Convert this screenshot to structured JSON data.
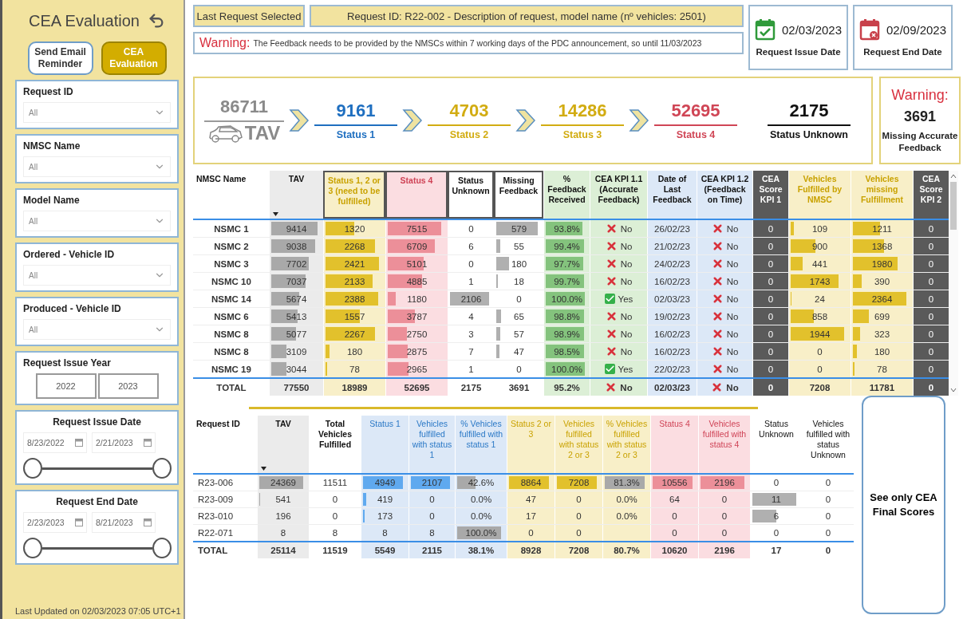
{
  "sidebar": {
    "title": "CEA Evaluation",
    "buttons": [
      {
        "label": "Send Email Reminder",
        "selected": false
      },
      {
        "label": "CEA Evaluation",
        "selected": true
      }
    ],
    "filters": [
      {
        "kind": "dropdown",
        "label": "Request ID",
        "placeholder": "All"
      },
      {
        "kind": "dropdown",
        "label": "NMSC Name",
        "placeholder": "All"
      },
      {
        "kind": "dropdown",
        "label": "Model Name",
        "placeholder": "All"
      },
      {
        "kind": "dropdown",
        "label": "Ordered - Vehicle ID",
        "placeholder": "All"
      },
      {
        "kind": "dropdown",
        "label": "Produced - Vehicle ID",
        "placeholder": "All"
      },
      {
        "kind": "years",
        "label": "Request Issue Year",
        "options": [
          "2022",
          "2023"
        ]
      },
      {
        "kind": "daterange",
        "label": "Request Issue Date",
        "start": "8/23/2022",
        "end": "2/21/2023"
      },
      {
        "kind": "daterange",
        "label": "Request End Date",
        "start": "2/23/2023",
        "end": "8/21/2023"
      }
    ],
    "footer": "Last Updated on 02/03/2023 07:05 UTC+1"
  },
  "header": {
    "selection_label": "Last Request Selected",
    "request": "Request ID: R22-002 - Description of request, model name (nº vehicles: 2501)",
    "warning": {
      "label": "Warning:",
      "text": "The Feedback needs to be provided by the NMSCs within 7 working days of the PDC announcement, so until 11/03/2023"
    },
    "dates": [
      {
        "kind": "issue",
        "value": "02/03/2023",
        "label": "Request Issue Date"
      },
      {
        "kind": "end",
        "value": "02/09/2023",
        "label": "Request End Date"
      }
    ]
  },
  "summary": {
    "tav": {
      "value": "86711",
      "label": "TAV"
    },
    "statuses": [
      {
        "value": "9161",
        "label": "Status 1",
        "color": "#1f6fc0",
        "chevron": true
      },
      {
        "value": "4703",
        "label": "Status 2",
        "color": "#d2ac12",
        "chevron": true
      },
      {
        "value": "14286",
        "label": "Status 3",
        "color": "#d2ac12",
        "chevron": true
      },
      {
        "value": "52695",
        "label": "Status 4",
        "color": "#d04656",
        "chevron": true
      },
      {
        "value": "2175",
        "label": "Status Unknown",
        "color": "#111111"
      }
    ],
    "warning": {
      "title": "Warning:",
      "value": "3691",
      "label": "Missing Accurate Feedback"
    }
  },
  "nmsc_table": {
    "columns": [
      {
        "label": "NMSC Name",
        "kind": "label"
      },
      {
        "label": "TAV",
        "kind": "gray",
        "sort": true
      },
      {
        "label": "Status 1, 2 or 3 (need to be fulfilled)",
        "kind": "yellow",
        "boxed": true
      },
      {
        "label": "Status 4",
        "kind": "red",
        "boxed": true
      },
      {
        "label": "Status Unknown",
        "kind": "count",
        "boxed": true
      },
      {
        "label": "Missing Feedback",
        "kind": "count",
        "boxed": true
      },
      {
        "label": "% Feedback Received",
        "kind": "percent"
      },
      {
        "label": "CEA KPI 1.1 (Accurate Feedback)",
        "kind": "green"
      },
      {
        "label": "Date of Last Feedback",
        "kind": "blue"
      },
      {
        "label": "CEA KPI 1.2 (Feedback on Time)",
        "kind": "blue"
      },
      {
        "label": "CEA Score KPI 1",
        "kind": "score"
      },
      {
        "label": "Vehicles Fulfilled by NMSC",
        "kind": "yellow"
      },
      {
        "label": "Vehicles missing Fulfillment",
        "kind": "yellow"
      },
      {
        "label": "CEA Score KPI 2",
        "kind": "score"
      }
    ],
    "rows": [
      {
        "cells": [
          "NSMC 1",
          "9414",
          "1320",
          "7515",
          "0",
          "579",
          "93.8%",
          {
            "text": "No",
            "ok": false
          },
          "26/02/23",
          {
            "text": "No",
            "ok": false
          },
          "0",
          "109",
          "1211",
          "0"
        ]
      },
      {
        "cells": [
          "NSMC 2",
          "9038",
          "2268",
          "6709",
          "6",
          "55",
          "99.4%",
          {
            "text": "No",
            "ok": false
          },
          "21/02/23",
          {
            "text": "No",
            "ok": false
          },
          "0",
          "900",
          "1368",
          "0"
        ]
      },
      {
        "cells": [
          "NSMC 3",
          "7702",
          "2421",
          "5101",
          "0",
          "180",
          "97.7%",
          {
            "text": "No",
            "ok": false
          },
          "24/02/23",
          {
            "text": "No",
            "ok": false
          },
          "0",
          "441",
          "1980",
          "0"
        ]
      },
      {
        "cells": [
          "NSMC 10",
          "7037",
          "2133",
          "4885",
          "1",
          "18",
          "99.7%",
          {
            "text": "No",
            "ok": false
          },
          "16/02/23",
          {
            "text": "No",
            "ok": false
          },
          "0",
          "1743",
          "390",
          "0"
        ]
      },
      {
        "cells": [
          "NSMC 14",
          "5674",
          "2388",
          "1180",
          "2106",
          "0",
          "100.0%",
          {
            "text": "Yes",
            "ok": true
          },
          "02/03/23",
          {
            "text": "No",
            "ok": false
          },
          "0",
          "24",
          "2364",
          "0"
        ]
      },
      {
        "cells": [
          "NSMC 6",
          "5413",
          "1557",
          "3787",
          "4",
          "65",
          "98.8%",
          {
            "text": "No",
            "ok": false
          },
          "19/02/23",
          {
            "text": "No",
            "ok": false
          },
          "0",
          "858",
          "699",
          "0"
        ]
      },
      {
        "cells": [
          "NSMC 8",
          "5077",
          "2267",
          "2750",
          "3",
          "57",
          "98.9%",
          {
            "text": "No",
            "ok": false
          },
          "16/02/23",
          {
            "text": "No",
            "ok": false
          },
          "0",
          "1944",
          "323",
          "0"
        ]
      },
      {
        "cells": [
          "NSMC 8",
          "3109",
          "180",
          "2875",
          "7",
          "47",
          "98.5%",
          {
            "text": "No",
            "ok": false
          },
          "16/02/23",
          {
            "text": "No",
            "ok": false
          },
          "0",
          "0",
          "180",
          "0"
        ]
      },
      {
        "cells": [
          "NSMC 19",
          "3044",
          "78",
          "2965",
          "1",
          "0",
          "100.0%",
          {
            "text": "Yes",
            "ok": true
          },
          "22/02/23",
          {
            "text": "No",
            "ok": false
          },
          "0",
          "0",
          "78",
          "0"
        ]
      }
    ],
    "total": {
      "cells": [
        "TOTAL",
        "77550",
        "18989",
        "52695",
        "2175",
        "3691",
        "95.2%",
        {
          "text": "No",
          "ok": false
        },
        "02/03/23",
        {
          "text": "No",
          "ok": false
        },
        "0",
        "7208",
        "11781",
        "0"
      ]
    }
  },
  "request_table": {
    "columns": [
      {
        "label": "Request ID",
        "kind": "label"
      },
      {
        "label": "TAV",
        "kind": "gray",
        "sort": true
      },
      {
        "label": "Total Vehicles Fulfilled",
        "kind": "plain"
      },
      {
        "label": "Status 1",
        "kind": "sky"
      },
      {
        "label": "Vehicles fulfilled with status 1",
        "kind": "sky"
      },
      {
        "label": "% Vehicles fulfilled with status 1",
        "kind": "skyshare"
      },
      {
        "label": "Status 2 or 3",
        "kind": "yellow"
      },
      {
        "label": "Vehicles fulfilled with status 2 or 3",
        "kind": "yellow"
      },
      {
        "label": "% Vehicles fulfilled with status 2 or 3",
        "kind": "yellowshare"
      },
      {
        "label": "Status 4",
        "kind": "red"
      },
      {
        "label": "Vehicles fulfilled with status 4",
        "kind": "red"
      },
      {
        "label": "Status Unknown",
        "kind": "count"
      },
      {
        "label": "Vehicles fulfilled with status Unknown",
        "kind": "muted"
      }
    ],
    "rows": [
      {
        "cells": [
          "R23-006",
          "24369",
          "11511",
          "4949",
          "2107",
          "42.6%",
          "8864",
          "7208",
          "81.3%",
          "10556",
          "2196",
          "0",
          "0"
        ]
      },
      {
        "cells": [
          "R23-009",
          "541",
          "0",
          "419",
          "0",
          "0.0%",
          "47",
          "0",
          "0.0%",
          "64",
          "0",
          "11",
          "0"
        ]
      },
      {
        "cells": [
          "R23-010",
          "196",
          "0",
          "173",
          "0",
          "0.0%",
          "17",
          "0",
          "0.0%",
          "0",
          "0",
          "6",
          "0"
        ]
      },
      {
        "cells": [
          "R22-071",
          "8",
          "8",
          "8",
          "8",
          "100.0%",
          "0",
          "0",
          null,
          "0",
          "0",
          "0",
          "0"
        ]
      }
    ],
    "total": {
      "cells": [
        "TOTAL",
        "25114",
        "11519",
        "5549",
        "2115",
        "38.1%",
        "8928",
        "7208",
        "80.7%",
        "10620",
        "2196",
        "17",
        "0"
      ]
    }
  },
  "final_scores_button": "See only CEA Final Scores"
}
